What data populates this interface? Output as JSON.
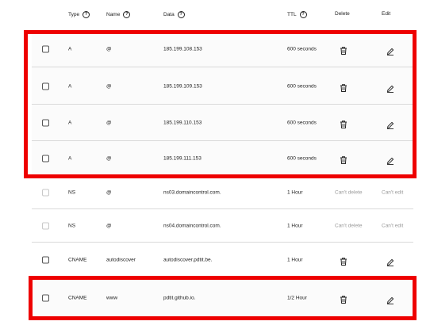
{
  "header": {
    "type": "Type",
    "name": "Name",
    "data": "Data",
    "ttl": "TTL",
    "delete": "Delete",
    "edit": "Edit"
  },
  "records": [
    {
      "type": "A",
      "name": "@",
      "data": "185.199.108.153",
      "ttl": "600 seconds",
      "editable": true
    },
    {
      "type": "A",
      "name": "@",
      "data": "185.199.109.153",
      "ttl": "600 seconds",
      "editable": true
    },
    {
      "type": "A",
      "name": "@",
      "data": "185.199.110.153",
      "ttl": "600 seconds",
      "editable": true
    },
    {
      "type": "A",
      "name": "@",
      "data": "185.199.111.153",
      "ttl": "600 seconds",
      "editable": true
    },
    {
      "type": "NS",
      "name": "@",
      "data": "ns03.domaincontrol.com.",
      "ttl": "1 Hour",
      "editable": false,
      "delete_text": "Can't delete",
      "edit_text": "Can't edit"
    },
    {
      "type": "NS",
      "name": "@",
      "data": "ns04.domaincontrol.com.",
      "ttl": "1 Hour",
      "editable": false,
      "delete_text": "Can't delete",
      "edit_text": "Can't edit"
    },
    {
      "type": "CNAME",
      "name": "autodiscover",
      "data": "autodiscover.pdtit.be.",
      "ttl": "1 Hour",
      "editable": true
    },
    {
      "type": "CNAME",
      "name": "www",
      "data": "pdtit.github.io.",
      "ttl": "1/2 Hour",
      "editable": true
    }
  ],
  "annotation_color": "#ee0000"
}
